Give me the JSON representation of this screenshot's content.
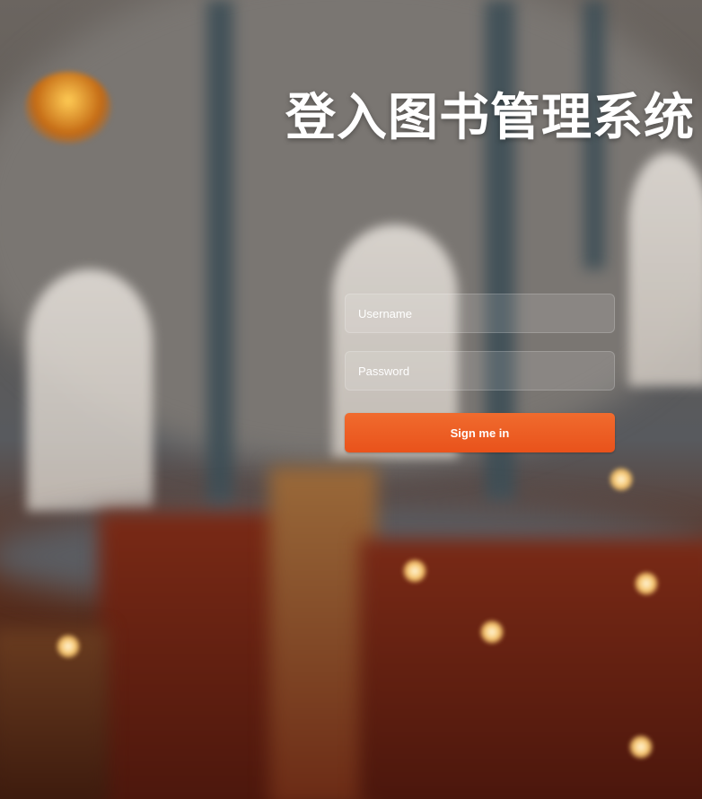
{
  "page": {
    "title": "登入图书管理系统"
  },
  "login_form": {
    "username_placeholder": "Username",
    "username_value": "",
    "password_placeholder": "Password",
    "password_value": "",
    "submit_label": "Sign me in"
  },
  "colors": {
    "accent": "#ef5d22",
    "title_text": "#ffffff"
  }
}
